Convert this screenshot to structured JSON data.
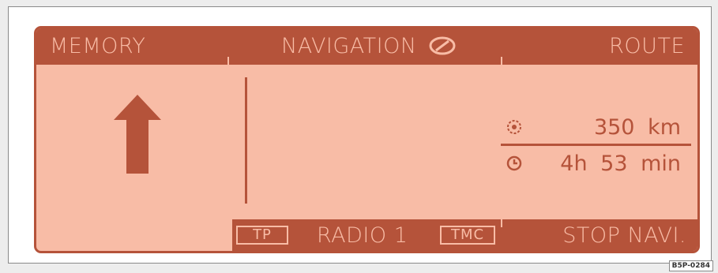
{
  "top_bar": {
    "left_label": "MEMORY",
    "center_label": "NAVIGATION",
    "right_label": "ROUTE",
    "center_icon": "compass-icon"
  },
  "route_info": {
    "distance_icon": "destination-target-icon",
    "distance_value": "350 km",
    "time_icon": "clock-icon",
    "time_value": "4h 53 min"
  },
  "maneuver": {
    "icon": "arrow-straight-ahead-icon"
  },
  "bottom_bar": {
    "tp_label": "TP",
    "source_label": "RADIO 1",
    "tmc_label": "TMC",
    "right_label": "STOP NAVI."
  },
  "figure_code": "B5P-0284",
  "colors": {
    "display_background": "#f8bca6",
    "display_foreground": "#b5533a"
  }
}
